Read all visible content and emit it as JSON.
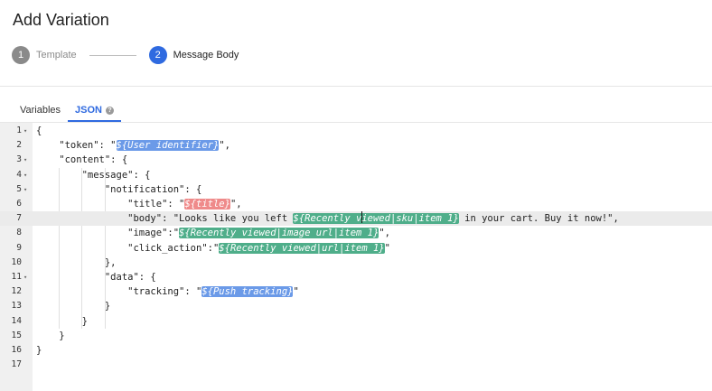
{
  "page": {
    "title": "Add Variation"
  },
  "stepper": {
    "steps": [
      {
        "number": "1",
        "label": "Template"
      },
      {
        "number": "2",
        "label": "Message Body"
      }
    ]
  },
  "tabs": [
    {
      "label": "Variables"
    },
    {
      "label": "JSON",
      "help_icon": "?"
    }
  ],
  "colors": {
    "accent": "#2f6ae0",
    "token_user": "#6b9ae8",
    "token_title": "#ef8a8a",
    "token_recent": "#4fae8a"
  },
  "editor": {
    "active_line": 7,
    "lines": [
      {
        "n": "1",
        "fold": true,
        "t": [
          [
            "p",
            "{"
          ]
        ]
      },
      {
        "n": "2",
        "t": [
          [
            "p",
            "    \"token\": \""
          ],
          [
            "blue",
            "${User identifier}"
          ],
          [
            "p",
            "\","
          ]
        ]
      },
      {
        "n": "3",
        "fold": true,
        "t": [
          [
            "p",
            "    \"content\": {"
          ]
        ]
      },
      {
        "n": "4",
        "fold": true,
        "t": [
          [
            "p",
            "        \"message\": {"
          ]
        ]
      },
      {
        "n": "5",
        "fold": true,
        "t": [
          [
            "p",
            "            \"notification\": {"
          ]
        ]
      },
      {
        "n": "6",
        "t": [
          [
            "p",
            "                \"title\": \""
          ],
          [
            "red",
            "${title}"
          ],
          [
            "p",
            "\","
          ]
        ]
      },
      {
        "n": "7",
        "t": [
          [
            "p",
            "                \"body\": \"Looks like you left "
          ],
          [
            "green",
            "${Recently viewed|sku|item 1}"
          ],
          [
            "p",
            " in your cart. Buy it now!\","
          ]
        ]
      },
      {
        "n": "8",
        "t": [
          [
            "p",
            "                \"image\":\""
          ],
          [
            "green",
            "${Recently viewed|image url|item 1}"
          ],
          [
            "p",
            "\","
          ]
        ]
      },
      {
        "n": "9",
        "t": [
          [
            "p",
            "                \"click_action\":\""
          ],
          [
            "green",
            "${Recently viewed|url|item 1}"
          ],
          [
            "p",
            "\""
          ]
        ]
      },
      {
        "n": "10",
        "t": [
          [
            "p",
            "            },"
          ]
        ]
      },
      {
        "n": "11",
        "fold": true,
        "t": [
          [
            "p",
            "            \"data\": {"
          ]
        ]
      },
      {
        "n": "12",
        "t": [
          [
            "p",
            "                \"tracking\": \""
          ],
          [
            "blue",
            "${Push tracking}"
          ],
          [
            "p",
            "\""
          ]
        ]
      },
      {
        "n": "13",
        "t": [
          [
            "p",
            "            }"
          ]
        ]
      },
      {
        "n": "14",
        "t": [
          [
            "p",
            "        }"
          ]
        ]
      },
      {
        "n": "15",
        "t": [
          [
            "p",
            "    }"
          ]
        ]
      },
      {
        "n": "16",
        "t": [
          [
            "p",
            "}"
          ]
        ]
      },
      {
        "n": "17",
        "t": []
      }
    ]
  }
}
